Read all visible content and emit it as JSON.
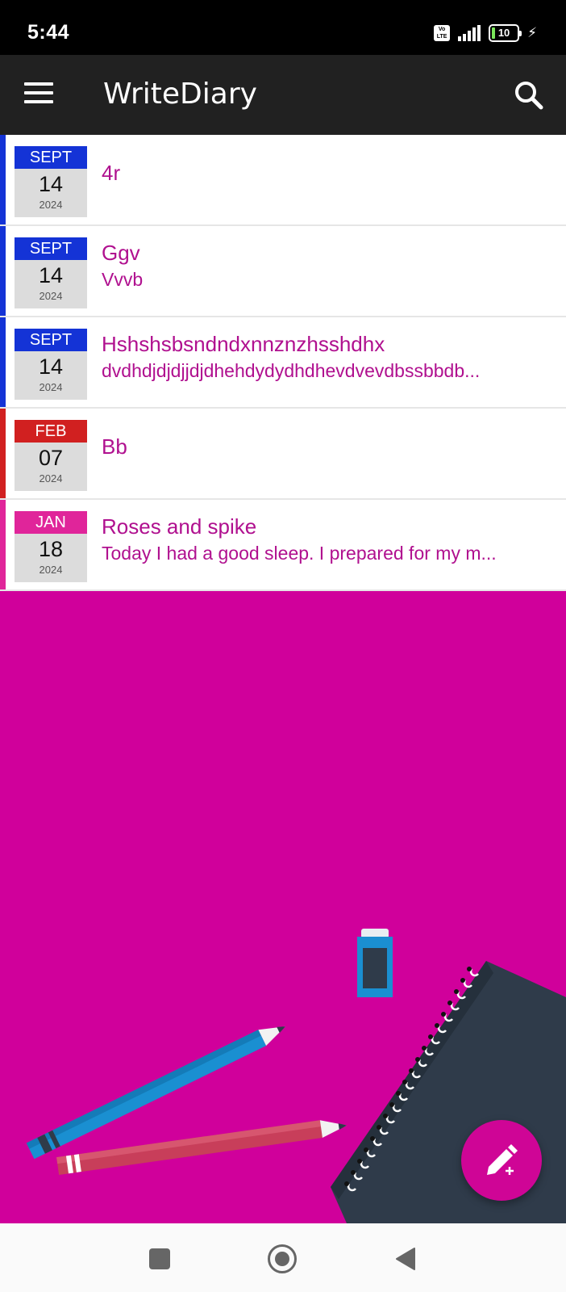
{
  "status_bar": {
    "time": "5:44",
    "volte": "Vo LTE",
    "battery": "10"
  },
  "app_bar": {
    "title": "WriteDiary"
  },
  "entries": [
    {
      "month": "SEPT",
      "day": "14",
      "year": "2024",
      "title": "4r",
      "body": "",
      "accent": "#1433d6"
    },
    {
      "month": "SEPT",
      "day": "14",
      "year": "2024",
      "title": "Ggv",
      "body": "Vvvb",
      "accent": "#1433d6"
    },
    {
      "month": "SEPT",
      "day": "14",
      "year": "2024",
      "title": "Hshshsbsndndxnnznzhsshdhx",
      "body": "dvdhdjdjdjjdjdhehdydydhdhevdvevdbssbbdb...",
      "accent": "#1433d6"
    },
    {
      "month": "FEB",
      "day": "07",
      "year": "2024",
      "title": "Bb",
      "body": "",
      "accent": "#d12020"
    },
    {
      "month": "JAN",
      "day": "18",
      "year": "2024",
      "title": "Roses and spike",
      "body": "Today I had a good sleep. I prepared for my m...",
      "accent": "#e0259a"
    }
  ],
  "icons": {
    "menu": "menu-icon",
    "search": "search-icon",
    "fab": "edit-add-icon",
    "nav_recents": "square-icon",
    "nav_home": "circle-icon",
    "nav_back": "triangle-back-icon"
  },
  "colors": {
    "background": "#d0009b",
    "app_bar": "#212121",
    "entry_text": "#b0108f",
    "fab": "#cf0596"
  }
}
